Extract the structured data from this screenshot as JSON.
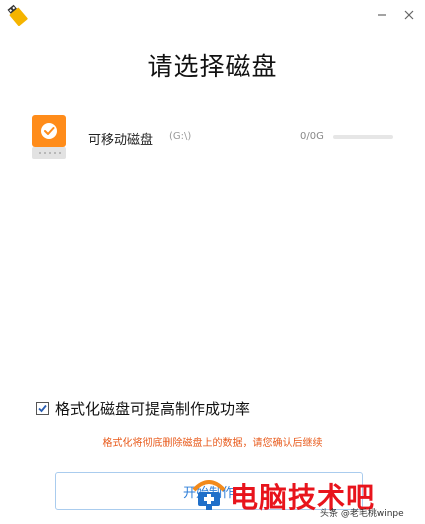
{
  "header": {
    "title": "请选择磁盘"
  },
  "disks": [
    {
      "name": "可移动磁盘",
      "drive": "(G:\\)",
      "capacity": "0/0G",
      "usage_fraction": 0
    }
  ],
  "options": {
    "format_label": "格式化磁盘可提高制作成功率",
    "format_checked": true
  },
  "warning": "格式化将彻底删除磁盘上的数据，请您确认后继续",
  "actions": {
    "start_label": "开始制作"
  },
  "watermark": {
    "text": "电脑技术吧",
    "attribution": "头条 @老毛桃winpe"
  },
  "colors": {
    "accent_orange": "#ff8c1a",
    "warning": "#e85a1b",
    "button_text": "#2f7fd8",
    "watermark_red": "#e8141c"
  },
  "icons": {
    "app": "usb-drive-icon",
    "minimize": "minimize-icon",
    "close": "close-icon",
    "disk": "removable-disk-icon",
    "check": "checkmark-icon"
  }
}
